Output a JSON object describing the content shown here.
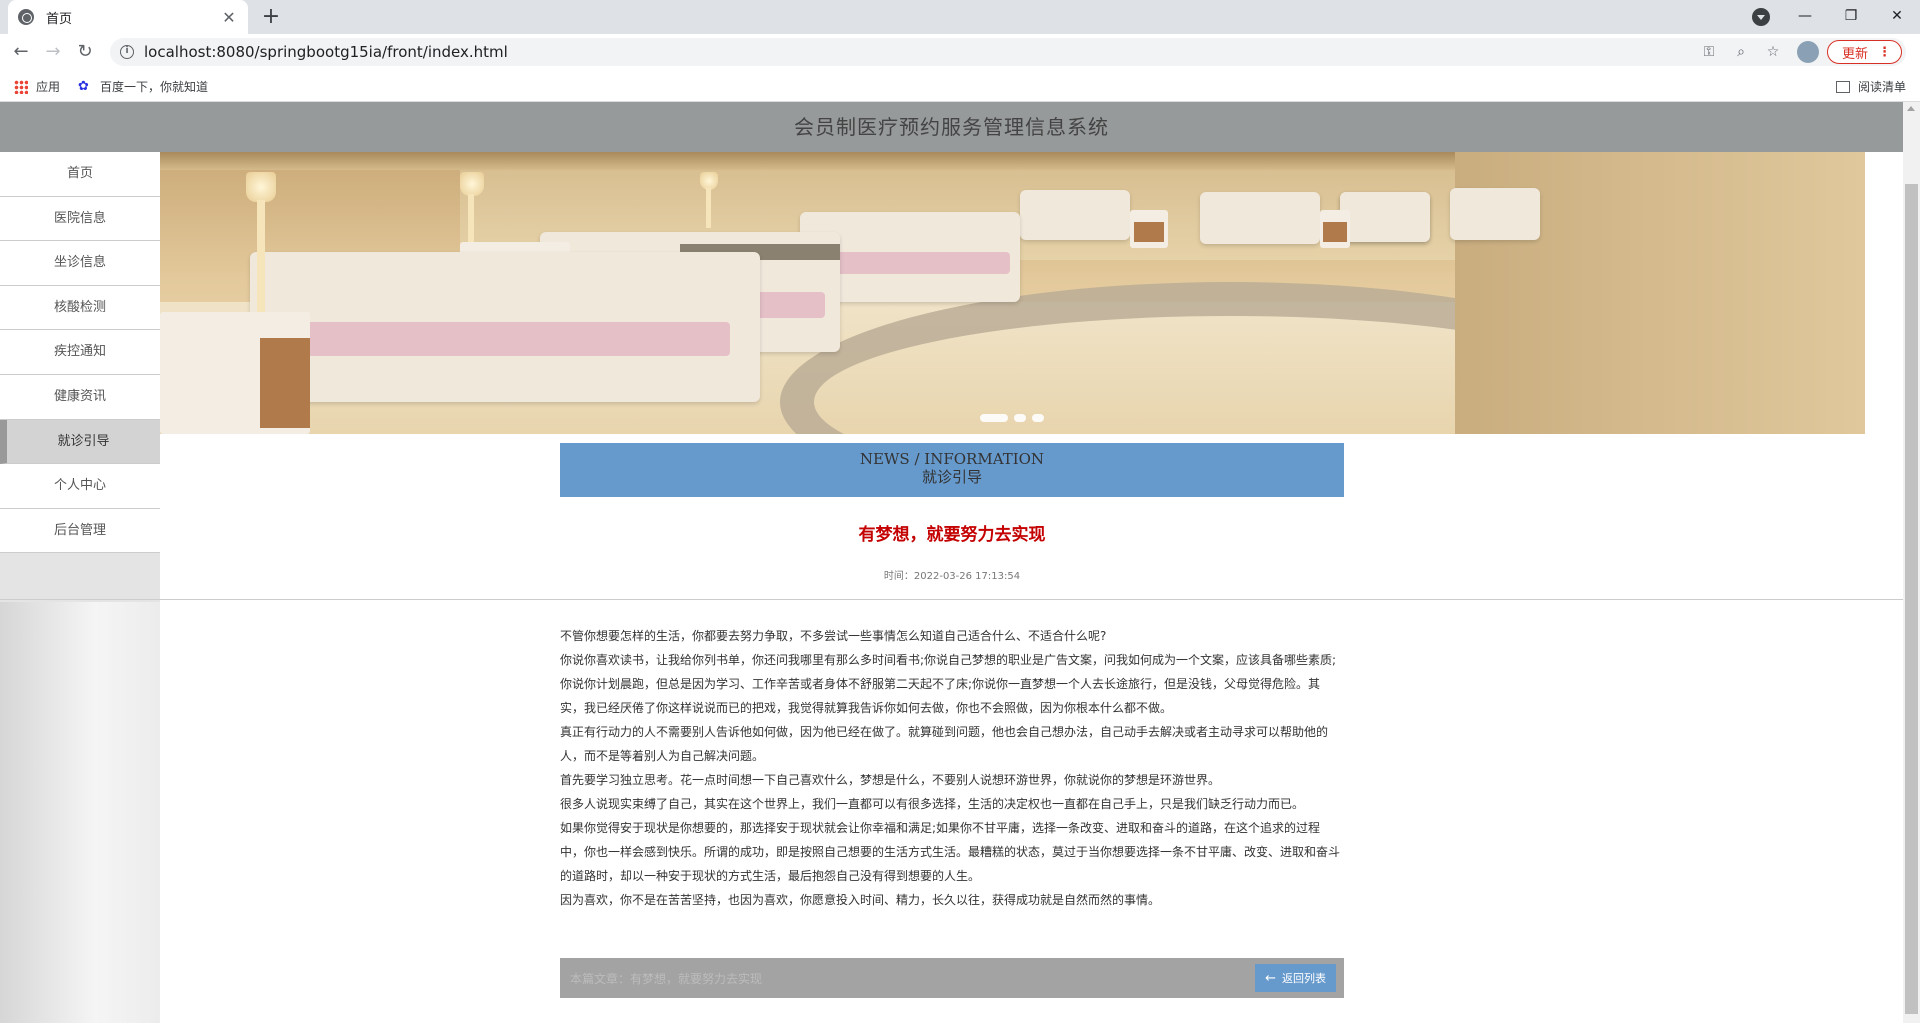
{
  "browser": {
    "tab_title": "首页",
    "url": "localhost:8080/springbootg15ia/front/index.html",
    "update_label": "更新",
    "bookmarks": [
      "应用",
      "百度一下，你就知道"
    ],
    "reading_list": "阅读清单"
  },
  "site": {
    "title": "会员制医疗预约服务管理信息系统"
  },
  "sidebar": {
    "items": [
      {
        "label": "首页"
      },
      {
        "label": "医院信息"
      },
      {
        "label": "坐诊信息"
      },
      {
        "label": "核酸检测"
      },
      {
        "label": "疾控通知"
      },
      {
        "label": "健康资讯"
      },
      {
        "label": "就诊引导",
        "active": true
      },
      {
        "label": "个人中心"
      },
      {
        "label": "后台管理"
      }
    ]
  },
  "banner": {
    "slide_count": 3,
    "active_slide": 1
  },
  "news": {
    "heading_en": "NEWS / INFORMATION",
    "heading_cn": "就诊引导"
  },
  "article": {
    "title": "有梦想，就要努力去实现",
    "time": "时间：2022-03-26 17:13:54",
    "paragraphs": [
      "不管你想要怎样的生活，你都要去努力争取，不多尝试一些事情怎么知道自己适合什么、不适合什么呢?",
      "你说你喜欢读书，让我给你列书单，你还问我哪里有那么多时间看书;你说自己梦想的职业是广告文案，问我如何成为一个文案，应该具备哪些素质;你说你计划晨跑，但总是因为学习、工作辛苦或者身体不舒服第二天起不了床;你说你一直梦想一个人去长途旅行，但是没钱，父母觉得危险。其实，我已经厌倦了你这样说说而已的把戏，我觉得就算我告诉你如何去做，你也不会照做，因为你根本什么都不做。",
      "真正有行动力的人不需要别人告诉他如何做，因为他已经在做了。就算碰到问题，他也会自己想办法，自己动手去解决或者主动寻求可以帮助他的人，而不是等着别人为自己解决问题。",
      "首先要学习独立思考。花一点时间想一下自己喜欢什么，梦想是什么，不要别人说想环游世界，你就说你的梦想是环游世界。",
      "很多人说现实束缚了自己，其实在这个世界上，我们一直都可以有很多选择，生活的决定权也一直都在自己手上，只是我们缺乏行动力而已。",
      "如果你觉得安于现状是你想要的，那选择安于现状就会让你幸福和满足;如果你不甘平庸，选择一条改变、进取和奋斗的道路，在这个追求的过程中，你也一样会感到快乐。所谓的成功，即是按照自己想要的生活方式生活。最糟糕的状态，莫过于当你想要选择一条不甘平庸、改变、进取和奋斗的道路时，却以一种安于现状的方式生活，最后抱怨自己没有得到想要的人生。",
      "因为喜欢，你不是在苦苦坚持，也因为喜欢，你愿意投入时间、精力，长久以往，获得成功就是自然而然的事情。"
    ]
  },
  "footer": {
    "current_article": "本篇文章：有梦想，就要努力去实现",
    "back_label": "返回列表"
  },
  "colors": {
    "header_bg": "#969a9b",
    "news_bar": "#6699cc",
    "title_red": "#c40000",
    "back_button": "#6699cc"
  }
}
